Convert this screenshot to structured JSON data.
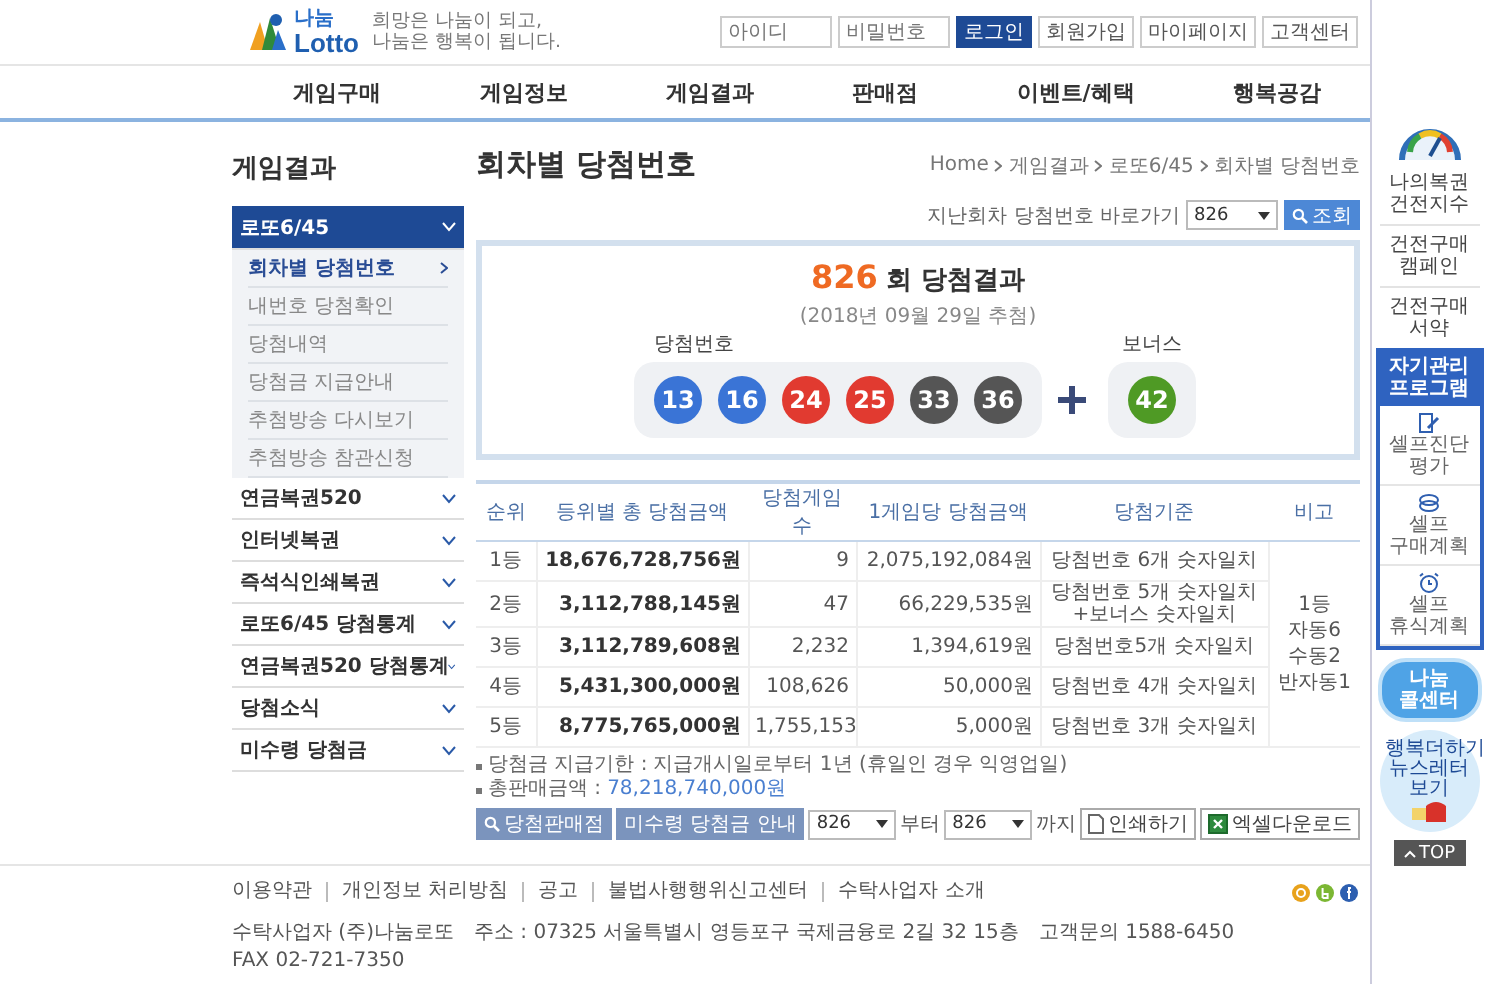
{
  "header": {
    "logo": {
      "small": "나눔",
      "large": "Lotto"
    },
    "tagline": "희망은 나눔이 되고, 나눔은 행복이 됩니다.",
    "id_field": {
      "placeholder": "아이디"
    },
    "password_field": {
      "placeholder": "비밀번호"
    },
    "buttons": [
      {
        "label": "로그인",
        "kind": "primary"
      },
      {
        "label": "회원가입",
        "kind": "plain"
      },
      {
        "label": "마이페이지",
        "kind": "plain"
      },
      {
        "label": "고객센터",
        "kind": "plain"
      }
    ]
  },
  "nav": [
    "게임구매",
    "게임정보",
    "게임결과",
    "판매점",
    "이벤트/혜택",
    "행복공감"
  ],
  "sidebar": {
    "title": "게임결과",
    "items": [
      {
        "label": "로또6/45",
        "expanded": true,
        "children": [
          {
            "label": "회차별 당첨번호",
            "selected": true
          },
          {
            "label": "내번호 당첨확인",
            "selected": false
          },
          {
            "label": "당첨내역",
            "selected": false
          },
          {
            "label": "당첨금 지급안내",
            "selected": false
          },
          {
            "label": "추첨방송 다시보기",
            "selected": false
          },
          {
            "label": "추첨방송 참관신청",
            "selected": false
          }
        ]
      },
      {
        "label": "연금복권520",
        "expanded": false
      },
      {
        "label": "인터넷복권",
        "expanded": false
      },
      {
        "label": "즉석식인쇄복권",
        "expanded": false
      },
      {
        "label": "로또6/45 당첨통계",
        "expanded": false
      },
      {
        "label": "연금복권520 당첨통계",
        "expanded": false
      },
      {
        "label": "당첨소식",
        "expanded": false
      },
      {
        "label": "미수령 당첨금",
        "expanded": false
      }
    ]
  },
  "page": {
    "title": "회차별 당첨번호",
    "breadcrumb": [
      "Home",
      "게임결과",
      "로또6/45",
      "회차별 당첨번호"
    ]
  },
  "round_picker": {
    "label": "지난회차 당첨번호 바로가기",
    "value": "826",
    "button": "조회"
  },
  "result": {
    "round": "826",
    "title": "회 당첨결과",
    "date": "(2018년 09월 29일 추첨)",
    "numbers_label": "당첨번호",
    "bonus_label": "보너스",
    "numbers": [
      {
        "value": "13",
        "color": "#3a74d6"
      },
      {
        "value": "16",
        "color": "#3a74d6"
      },
      {
        "value": "24",
        "color": "#e13a30"
      },
      {
        "value": "25",
        "color": "#e13a30"
      },
      {
        "value": "33",
        "color": "#555555"
      },
      {
        "value": "36",
        "color": "#555555"
      }
    ],
    "bonus": {
      "value": "42",
      "color": "#4f9a25"
    }
  },
  "table": {
    "columns": [
      "순위",
      "등위별 총 당첨금액",
      "당첨게임 수",
      "1게임당 당첨금액",
      "당첨기준",
      "비고"
    ],
    "rows": [
      {
        "rank": "1등",
        "total": "18,676,728,756원",
        "winners": "9",
        "per_game": "2,075,192,084원",
        "criteria": [
          "당첨번호 6개 숫자일치"
        ]
      },
      {
        "rank": "2등",
        "total": "3,112,788,145원",
        "winners": "47",
        "per_game": "66,229,535원",
        "criteria": [
          "당첨번호 5개 숫자일치",
          "+보너스 숫자일치"
        ]
      },
      {
        "rank": "3등",
        "total": "3,112,789,608원",
        "winners": "2,232",
        "per_game": "1,394,619원",
        "criteria": [
          "당첨번호5개 숫자일치"
        ]
      },
      {
        "rank": "4등",
        "total": "5,431,300,000원",
        "winners": "108,626",
        "per_game": "50,000원",
        "criteria": [
          "당첨번호 4개 숫자일치"
        ]
      },
      {
        "rank": "5등",
        "total": "8,775,765,000원",
        "winners": "1,755,153",
        "per_game": "5,000원",
        "criteria": [
          "당첨번호 3개 숫자일치"
        ]
      }
    ],
    "note": "1등 자동6 수동2 반자동1"
  },
  "notes": [
    {
      "label": "당첨금 지급기한 :",
      "value": "지급개시일로부터 1년 (휴일인 경우 익영업일)",
      "kind": "plain"
    },
    {
      "label": "총판매금액 :",
      "value": "78,218,740,000원",
      "kind": "highlight"
    }
  ],
  "actions": {
    "store_button": "당첨판매점",
    "unclaimed_button": "미수령 당첨금 안내",
    "from_select": "826",
    "from_label": "부터",
    "to_select": "826",
    "to_label": "까지",
    "print_button": "인쇄하기",
    "excel_button": "엑셀다운로드"
  },
  "footer": {
    "links": [
      "이용약관",
      "개인정보 처리방침",
      "공고",
      "불법사행행위신고센터",
      "수탁사업자 소개"
    ],
    "company": "수탁사업자 (주)나눔로또",
    "address": "주소 : 07325 서울특별시 영등포구 국제금융로 2길 32 15층",
    "phone": "고객문의 1588-6450",
    "fax": "FAX 02-721-7350"
  },
  "quick": {
    "index_label": "나의복권 건전지수",
    "links": [
      "건전구매 캠페인",
      "건전구매 서약"
    ],
    "program": {
      "title": "자기관리 프로그램",
      "items": [
        {
          "label": "셀프진단 평가",
          "kind": "check"
        },
        {
          "label": "셀프 구매계획",
          "kind": "plan"
        },
        {
          "label": "셀프 휴식계획",
          "kind": "alarm"
        }
      ]
    },
    "call_center": "나눔 콜센터",
    "newsletter": "행복더하기 뉴스레터 보기",
    "top": "TOP"
  }
}
